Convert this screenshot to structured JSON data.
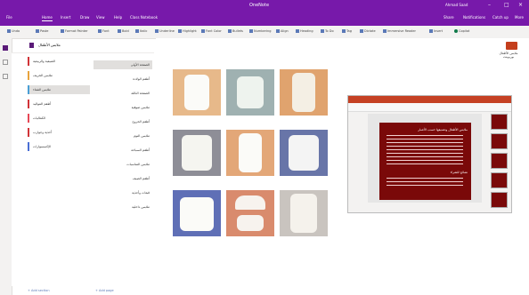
{
  "window": {
    "title": "OneNote",
    "user": "Ahmad Saad",
    "min": "–",
    "max": "□",
    "close": "×"
  },
  "menu": {
    "tabs": [
      "File",
      "Home",
      "Insert",
      "Draw",
      "View",
      "Help",
      "Class Notebook"
    ],
    "active_tab": 1,
    "right_items": [
      "Share",
      "Notifications",
      "Catch up",
      "More"
    ]
  },
  "ribbon": {
    "items": [
      "Undo",
      "Paste",
      "Format Painter",
      "Font",
      "Bold",
      "Italic",
      "Underline",
      "Highlight",
      "Font Color",
      "Bullets",
      "Numbering",
      "Align",
      "Heading",
      "To Do",
      "Tag",
      "Dictate",
      "Immersive Reader",
      "Insert",
      "Copilot"
    ]
  },
  "notebook": {
    "name": "ملابس الأطفال",
    "color": "#5a1a78"
  },
  "sections": [
    {
      "label": "الصيفية والربيعية",
      "color": "#d13438"
    },
    {
      "label": "ملابس الخريف",
      "color": "#e8a33d"
    },
    {
      "label": "ملابس الشتاء",
      "color": "#4a9fd5"
    },
    {
      "label": "أطقم المواليد",
      "color": "#d13438"
    },
    {
      "label": "الكماليات",
      "color": "#e74856"
    },
    {
      "label": "أحذية وجوارب",
      "color": "#d13438"
    },
    {
      "label": "الإكسسوارات",
      "color": "#4a6fd5"
    }
  ],
  "selected_section": 2,
  "pages": [
    "الصفحة الأولى",
    "أطقم الولادة",
    "الصفحة الثالثة",
    "ملابس صوفية",
    "أطقم الخروج",
    "ملابس النوم",
    "أطقم السباحة",
    "ملابس المناسبات",
    "أطقم الصيف",
    "قبعات وأحذية",
    "ملابس داخلية"
  ],
  "selected_page": 0,
  "bottom": {
    "add_section": "+ Add section",
    "add_page": "+ Add page"
  },
  "slide": {
    "title": "ملابس الأطفال وتصنيفها حسب الأعمار",
    "subtitle": "نصائح للشراء",
    "thumb_count": 5
  },
  "attachment": {
    "label": "ملابس الأطفال",
    "sub": "بوربوينت"
  },
  "photos": [
    {
      "bg": "#e7b98a",
      "cloth": "#fbfbf6"
    },
    {
      "bg": "#9fb1b1",
      "cloth": "#eef3ee"
    },
    {
      "bg": "#e0a36e",
      "cloth": "#f4efe4"
    },
    {
      "bg": "#8e8e97",
      "cloth": "#f5f5f0"
    },
    {
      "bg": "#e3a778",
      "cloth": "#fbfbf6"
    },
    {
      "bg": "#6875a8",
      "cloth": "#f4f4f4"
    },
    {
      "bg": "#5f6fb6",
      "cloth": "#fbfbfb"
    },
    {
      "bg": "#d98b6d",
      "cloth": "#f7f3ee"
    },
    {
      "bg": "#c9c4bf",
      "cloth": "#f5f2ec"
    }
  ]
}
